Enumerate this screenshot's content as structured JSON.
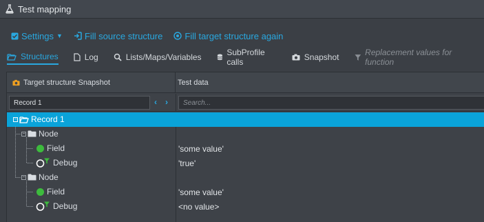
{
  "window": {
    "title": "Test mapping"
  },
  "toolbar": {
    "settings_label": "Settings",
    "fill_source_label": "Fill source structure",
    "fill_target_label": "Fill target structure again"
  },
  "tabs": [
    {
      "label": "Structures",
      "icon": "folder-open-icon",
      "active": true
    },
    {
      "label": "Log",
      "icon": "document-icon"
    },
    {
      "label": "Lists/Maps/Variables",
      "icon": "search-icon"
    },
    {
      "label": "SubProfile calls",
      "icon": "database-icon"
    },
    {
      "label": "Snapshot",
      "icon": "camera-icon"
    },
    {
      "label": "Replacement values for function",
      "icon": "filter-icon",
      "disabled": true
    }
  ],
  "grid": {
    "col1_header": "Target structure Snapshot",
    "col2_header": "Test data",
    "record_select_value": "Record 1",
    "search_placeholder": "Search..."
  },
  "tree": [
    {
      "label": "Record 1",
      "value": "",
      "type": "record",
      "selected": true
    },
    {
      "label": "Node",
      "value": "",
      "type": "node"
    },
    {
      "label": "Field",
      "value": "'some value'",
      "type": "field"
    },
    {
      "label": "Debug",
      "value": "'true'",
      "type": "debug"
    },
    {
      "label": "Node",
      "value": "",
      "type": "node"
    },
    {
      "label": "Field",
      "value": "'some value'",
      "type": "field"
    },
    {
      "label": "Debug",
      "value": "<no value>",
      "type": "debug"
    }
  ],
  "colors": {
    "accent": "#29a8e0",
    "selection": "#0aa3d9",
    "field_green": "#3dbb3d",
    "snapshot_orange": "#f0a020"
  }
}
